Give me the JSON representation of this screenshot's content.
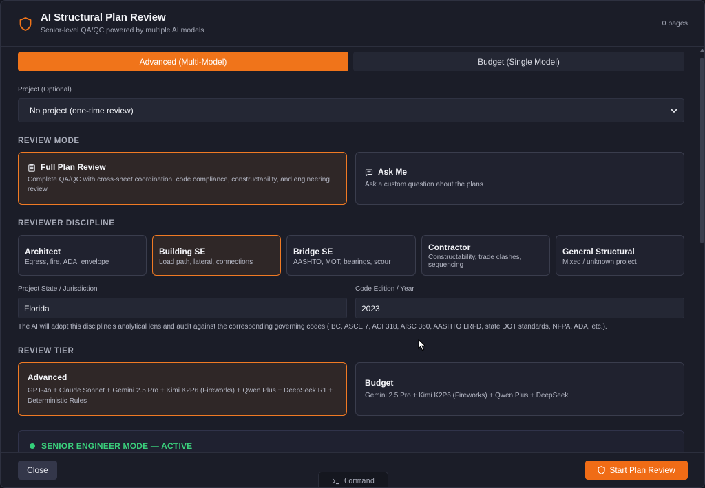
{
  "header": {
    "title": "AI Structural Plan Review",
    "subtitle": "Senior-level QA/QC powered by multiple AI models",
    "pages": "0 pages"
  },
  "tier_tabs": [
    {
      "label": "Advanced (Multi-Model)",
      "active": true
    },
    {
      "label": "Budget (Single Model)",
      "active": false
    }
  ],
  "project": {
    "label": "Project (Optional)",
    "selected": "No project (one-time review)"
  },
  "review_mode": {
    "heading": "REVIEW MODE",
    "options": [
      {
        "title": "Full Plan Review",
        "desc": "Complete QA/QC with cross-sheet coordination, code compliance, constructability, and engineering review",
        "selected": true,
        "icon": "clipboard-icon"
      },
      {
        "title": "Ask Me",
        "desc": "Ask a custom question about the plans",
        "selected": false,
        "icon": "chat-icon"
      }
    ]
  },
  "discipline": {
    "heading": "REVIEWER DISCIPLINE",
    "options": [
      {
        "title": "Architect",
        "desc": "Egress, fire, ADA, envelope",
        "selected": false
      },
      {
        "title": "Building SE",
        "desc": "Load path, lateral, connections",
        "selected": true
      },
      {
        "title": "Bridge SE",
        "desc": "AASHTO, MOT, bearings, scour",
        "selected": false
      },
      {
        "title": "Contractor",
        "desc": "Constructability, trade clashes, sequencing",
        "selected": false
      },
      {
        "title": "General Structural",
        "desc": "Mixed / unknown project",
        "selected": false
      }
    ]
  },
  "jurisdiction": {
    "state_label": "Project State / Jurisdiction",
    "state_value": "Florida",
    "code_label": "Code Edition / Year",
    "code_value": "2023",
    "hint": "The AI will adopt this discipline's analytical lens and audit against the corresponding governing codes (IBC, ASCE 7, ACI 318, AISC 360, AASHTO LRFD, state DOT standards, NFPA, ADA, etc.)."
  },
  "review_tier": {
    "heading": "REVIEW TIER",
    "options": [
      {
        "title": "Advanced",
        "desc": "GPT-4o + Claude Sonnet + Gemini 2.5 Pro + Kimi K2P6 (Fireworks) + Qwen Plus + DeepSeek R1 + Deterministic Rules",
        "selected": true
      },
      {
        "title": "Budget",
        "desc": "Gemini 2.5 Pro + Kimi K2P6 (Fireworks) + Qwen Plus + DeepSeek",
        "selected": false
      }
    ]
  },
  "senior_mode": {
    "text": "SENIOR ENGINEER MODE — ACTIVE"
  },
  "footer": {
    "close_label": "Close",
    "start_label": "Start Plan Review",
    "command_label": "Command"
  },
  "colors": {
    "accent": "#f0741a",
    "active_green": "#3ad07c",
    "background": "#1b1d28"
  }
}
